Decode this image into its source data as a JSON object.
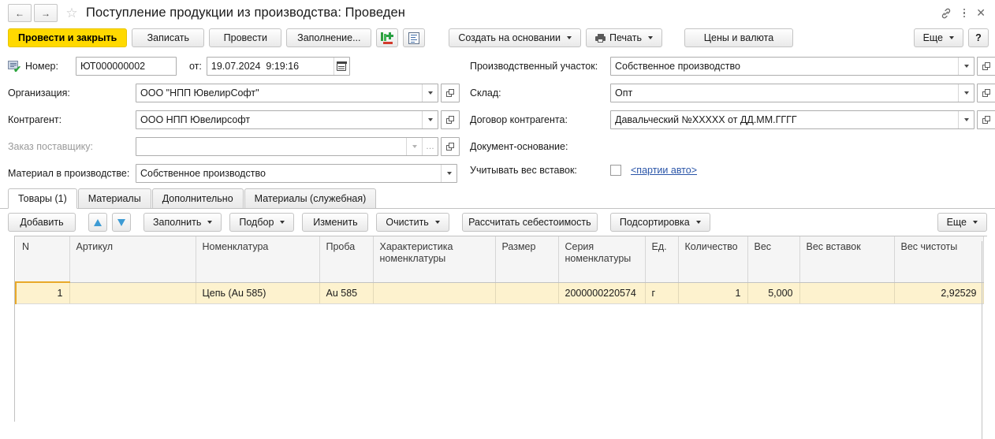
{
  "titlebar": {
    "back_label": "←",
    "forward_label": "→",
    "star_label": "☆",
    "title": "Поступление продукции из производства: Проведен",
    "link_icon": "link-icon",
    "menu_icon": "kebab-menu-icon",
    "close_label": "✕"
  },
  "commandbar": {
    "post_and_close": "Провести и закрыть",
    "write": "Записать",
    "post": "Провести",
    "fill": "Заполнение...",
    "icon_green_plus": "green-plus-doc-icon",
    "icon_list_doc": "list-document-icon",
    "create_on_basis": "Создать на основании",
    "print": "Печать",
    "prices_and_currency": "Цены и валюта",
    "more": "Еще",
    "help": "?"
  },
  "form": {
    "number_label": "Номер:",
    "number_value": "ЮТ000000002",
    "date_prefix": "от:",
    "date_value": "19.07.2024  9:19:16",
    "organization_label": "Организация:",
    "organization_value": "ООО \"НПП ЮвелирСофт\"",
    "counterparty_label": "Контрагент:",
    "counterparty_value": "ООО НПП Ювелирсофт",
    "supplier_order_label": "Заказ поставщику:",
    "supplier_order_value": "",
    "material_in_production_label": "Материал в производстве:",
    "material_in_production_value": "Собственное производство",
    "production_site_label": "Производственный участок:",
    "production_site_value": "Собственное производство",
    "warehouse_label": "Склад:",
    "warehouse_value": "Опт",
    "contract_label": "Договор контрагента:",
    "contract_value": "Давальческий №ХХХХХ от ДД.ММ.ГГГГ",
    "basis_document_label": "Документ-основание:",
    "account_insert_weight_label": "Учитывать вес вставок:",
    "batches_link": "<партии авто>"
  },
  "tabs": [
    {
      "label": "Товары (1)",
      "active": true
    },
    {
      "label": "Материалы",
      "active": false
    },
    {
      "label": "Дополнительно",
      "active": false
    },
    {
      "label": "Материалы (служебная)",
      "active": false
    }
  ],
  "table_toolbar": {
    "add": "Добавить",
    "move_up_icon": "arrow-up-icon",
    "move_down_icon": "arrow-down-icon",
    "fill": "Заполнить",
    "pick": "Подбор",
    "change": "Изменить",
    "clear": "Очистить",
    "calc_cost": "Рассчитать себестоимость",
    "subsort": "Подсортировка",
    "more": "Еще"
  },
  "grid": {
    "columns": [
      "N",
      "Артикул",
      "Номенклатура",
      "Проба",
      "Характеристика номенклатуры",
      "Размер",
      "Серия номенклатуры",
      "Ед.",
      "Количество",
      "Вес",
      "Вес вставок",
      "Вес чистоты"
    ],
    "rows": [
      {
        "n": "1",
        "article": "",
        "nomenclature": "Цепь (Au 585)",
        "assay": "Au 585",
        "characteristic": "",
        "size": "",
        "series": "2000000220574",
        "unit": "г",
        "quantity": "1",
        "weight": "5,000",
        "insert_weight": "",
        "pure_weight": "2,92529"
      }
    ]
  },
  "colors": {
    "accent_yellow": "#ffd900",
    "row_yellow": "#fdf2ce",
    "selected_cell": "#fcdf8a",
    "link_blue": "#2a55a8"
  }
}
